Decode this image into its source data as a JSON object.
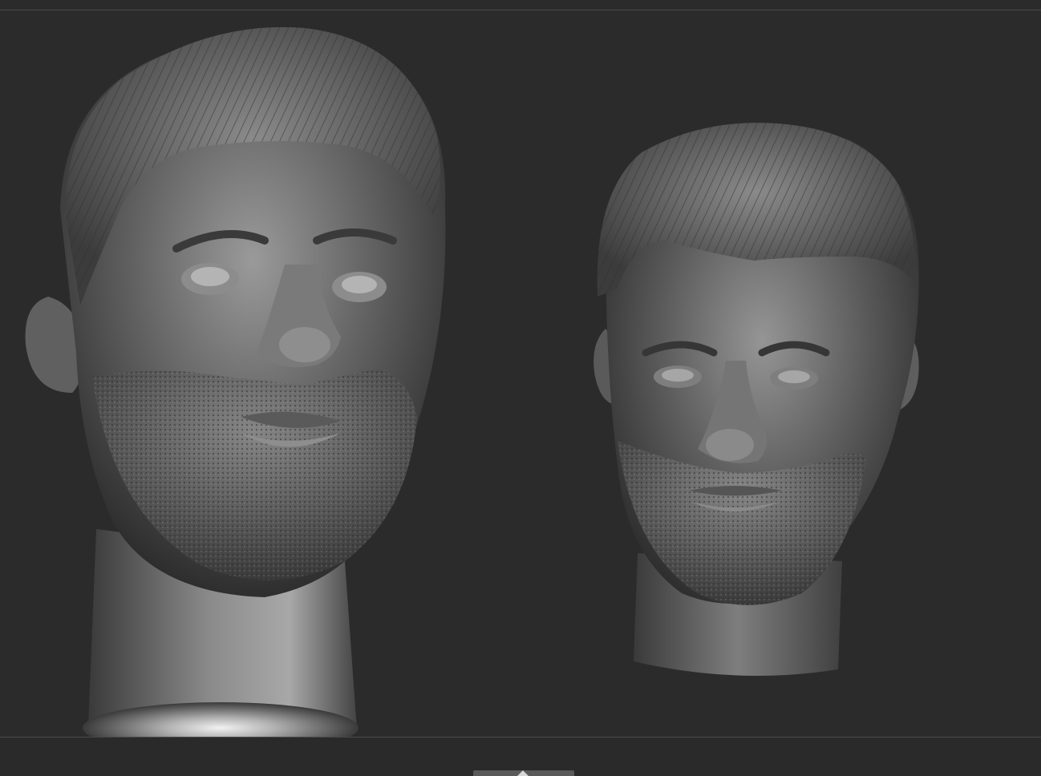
{
  "viewport": {
    "background": "#2b2b2b",
    "border_color": "#4a4a4a"
  },
  "models": [
    {
      "name": "head-sculpt-left",
      "material": "matcap-gray"
    },
    {
      "name": "head-sculpt-right",
      "material": "matcap-gray"
    }
  ],
  "bottom_shelf": {
    "toggle_icon": "chevron-up-icon"
  }
}
